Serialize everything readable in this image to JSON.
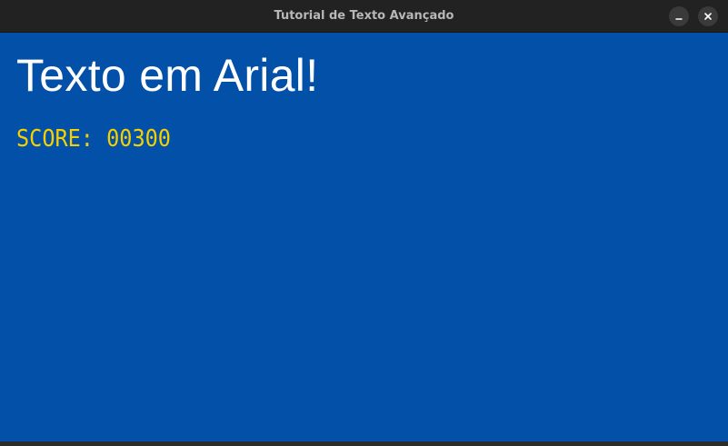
{
  "window": {
    "title": "Tutorial de Texto Avançado",
    "minimize_icon": "minimize-icon",
    "close_icon": "close-icon"
  },
  "content": {
    "arial_text": "Texto em Arial!",
    "score_text": "SCORE: 00300"
  },
  "colors": {
    "background": "#0350a8",
    "titlebar": "#222222",
    "arial_text": "#ffffff",
    "score_text": "#f5d000"
  }
}
